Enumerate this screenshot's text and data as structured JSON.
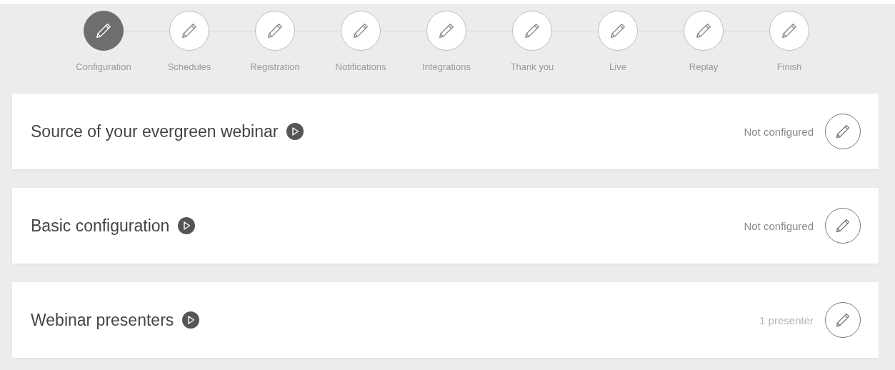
{
  "steps": [
    {
      "label": "Configuration",
      "selected": true
    },
    {
      "label": "Schedules",
      "selected": false
    },
    {
      "label": "Registration",
      "selected": false
    },
    {
      "label": "Notifications",
      "selected": false
    },
    {
      "label": "Integrations",
      "selected": false
    },
    {
      "label": "Thank you",
      "selected": false
    },
    {
      "label": "Live",
      "selected": false
    },
    {
      "label": "Replay",
      "selected": false
    },
    {
      "label": "Finish",
      "selected": false
    }
  ],
  "sections": [
    {
      "title": "Source of your evergreen webinar",
      "status": "Not configured",
      "configured": false
    },
    {
      "title": "Basic configuration",
      "status": "Not configured",
      "configured": false
    },
    {
      "title": "Webinar presenters",
      "status": "1 presenter",
      "configured": true
    }
  ]
}
